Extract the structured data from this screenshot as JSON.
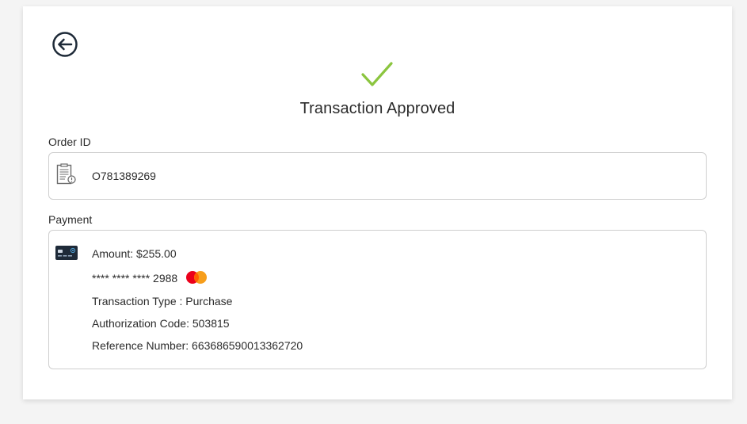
{
  "header": {
    "back_icon": "arrow-left-circle-icon",
    "status_icon": "checkmark-icon",
    "title": "Transaction Approved"
  },
  "order": {
    "label": "Order ID",
    "icon": "clipboard-document-icon",
    "value": "O781389269"
  },
  "payment": {
    "label": "Payment",
    "icon": "credit-card-icon",
    "amount": "Amount: $255.00",
    "card_number": "**** **** **** 2988",
    "card_brand_icon": "mastercard-logo",
    "transaction_type": "Transaction Type : Purchase",
    "authorization_code": "Authorization Code: 503815",
    "reference_number": "Reference Number: 663686590013362720"
  },
  "colors": {
    "check_green": "#8bc53f",
    "icon_dark": "#1e2a38",
    "mastercard_red": "#eb001b",
    "mastercard_orange": "#f79e1b",
    "border": "#cfcfcf"
  }
}
